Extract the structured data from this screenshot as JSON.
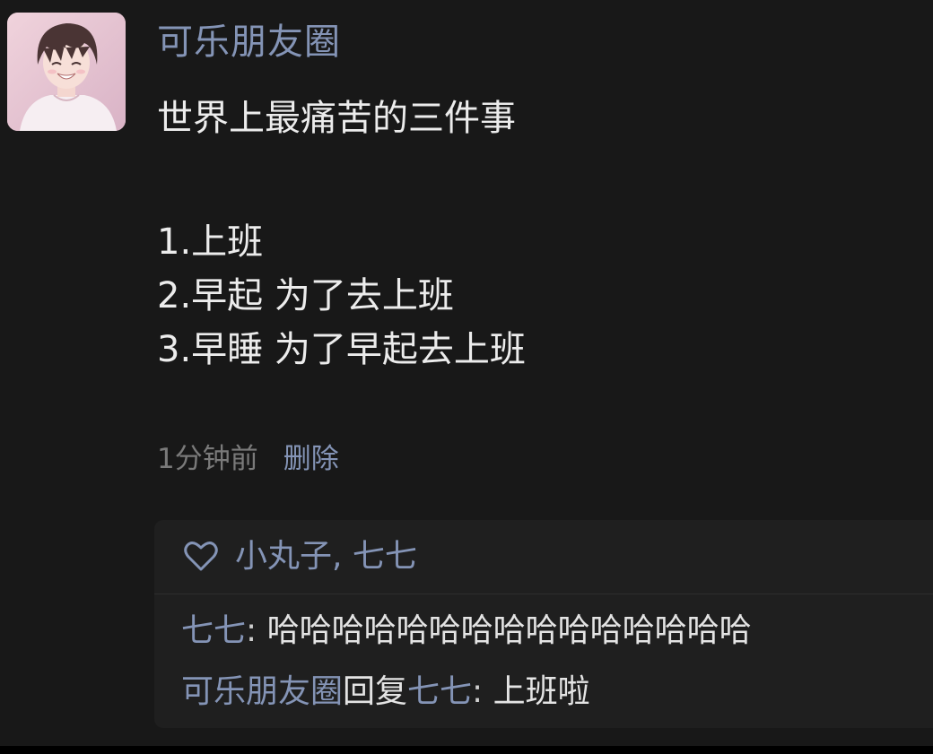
{
  "post": {
    "author": "可乐朋友圈",
    "lines": [
      "世界上最痛苦的三件事",
      "1.上班",
      "2.早起 为了去上班",
      "3.早睡 为了早起去上班"
    ],
    "time": "1分钟前",
    "delete_label": "删除"
  },
  "likes": {
    "icon": "heart-outline-icon",
    "names": "小丸子, 七七"
  },
  "comments": [
    {
      "author": "七七",
      "separator": ": ",
      "text": "哈哈哈哈哈哈哈哈哈哈哈哈哈哈哈"
    },
    {
      "author": "可乐朋友圈",
      "reply_word": "回复",
      "reply_to": "七七",
      "separator": ": ",
      "text": "上班啦"
    }
  ],
  "colors": {
    "background": "#181818",
    "link": "#8494b6",
    "text": "#ececec",
    "muted": "#7a7a7a",
    "panel": "#1f1f1f"
  }
}
